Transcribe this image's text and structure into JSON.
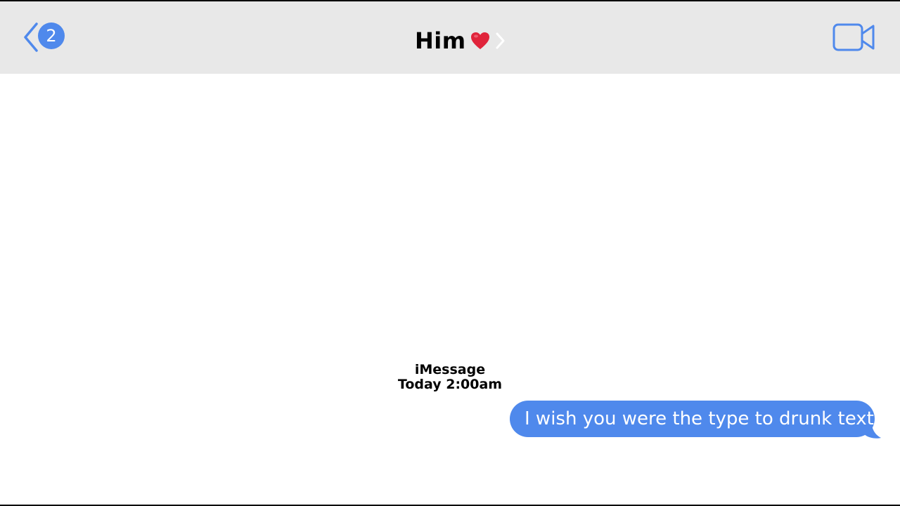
{
  "header": {
    "back_badge_count": "2",
    "contact_name": "Him",
    "back_icon": "chevron-left-icon",
    "heart_icon": "heart-icon",
    "disclosure_icon": "chevron-right-icon",
    "video_icon": "video-camera-icon"
  },
  "conversation": {
    "service_label": "iMessage",
    "timestamp": "Today 2:00am",
    "messages": [
      {
        "direction": "outgoing",
        "text": "I wish you were the type to drunk text"
      }
    ]
  },
  "colors": {
    "accent": "#4f89ec",
    "navbar_bg": "#e8e8e8",
    "heart": "#e0243b",
    "background": "#ffffff"
  }
}
